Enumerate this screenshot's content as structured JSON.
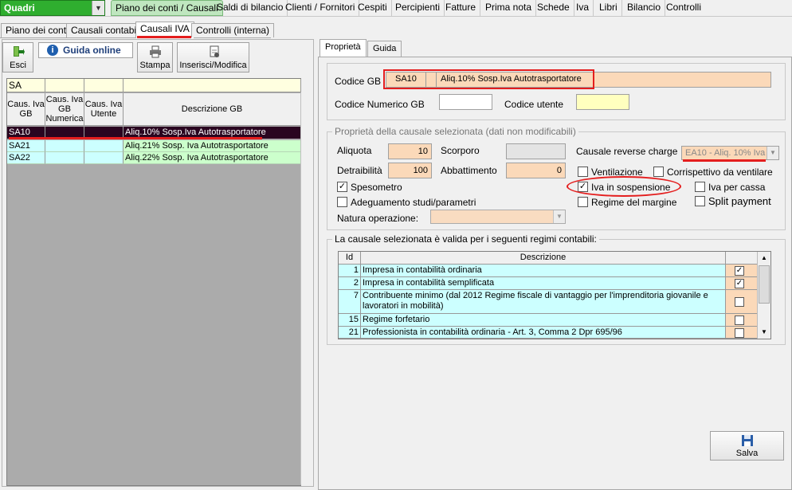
{
  "module_select": {
    "value": "Quadri"
  },
  "main_menu": [
    {
      "label": "Piano dei conti / Causali",
      "active": true
    },
    {
      "label": "Saldi di bilancio"
    },
    {
      "label": "Clienti / Fornitori"
    },
    {
      "label": "Cespiti"
    },
    {
      "label": "Percipienti"
    },
    {
      "label": "Fatture"
    },
    {
      "label": "Prima nota"
    },
    {
      "label": "Schede"
    },
    {
      "label": "Iva"
    },
    {
      "label": "Libri"
    },
    {
      "label": "Bilancio"
    },
    {
      "label": "Controlli"
    }
  ],
  "sub_tabs": [
    {
      "label": "Piano dei conti"
    },
    {
      "label": "Causali contabili"
    },
    {
      "label": "Causali IVA",
      "active": true
    },
    {
      "label": "Controlli (interna)"
    }
  ],
  "toolbar": {
    "esci": "Esci",
    "guida_online": "Guida online",
    "stampa": "Stampa",
    "inserisci_modifica": "Inserisci/Modifica"
  },
  "grid": {
    "filter_value": "SA",
    "headers": [
      "Caus. Iva GB",
      "Caus. Iva GB Numerica",
      "Caus. Iva Utente",
      "Descrizione GB"
    ],
    "rows": [
      {
        "code": "SA10",
        "numerica": "",
        "utente": "",
        "descrizione": "Aliq.10% Sosp.Iva Autotrasportatore",
        "selected": true
      },
      {
        "code": "SA21",
        "numerica": "",
        "utente": "",
        "descrizione": "Aliq.21% Sosp. Iva Autotrasportatore"
      },
      {
        "code": "SA22",
        "numerica": "",
        "utente": "",
        "descrizione": "Aliq.22% Sosp. Iva Autotrasportatore"
      }
    ]
  },
  "right_tabs": [
    {
      "label": "Proprietà",
      "active": true
    },
    {
      "label": "Guida"
    }
  ],
  "codice": {
    "codice_gb_label": "Codice GB",
    "codice_gb": "SA10",
    "descrizione": "Aliq.10% Sosp.Iva Autotrasportatore",
    "codice_numerico_label": "Codice Numerico GB",
    "codice_numerico": "",
    "codice_utente_label": "Codice utente",
    "codice_utente": ""
  },
  "proprieta": {
    "title": "Proprietà della causale selezionata (dati non modificabili)",
    "aliquota_label": "Aliquota",
    "aliquota": "10",
    "scorporo_label": "Scorporo",
    "scorporo": "",
    "detraibilita_label": "Detraibilità",
    "detraibilita": "100",
    "abbattimento_label": "Abbattimento",
    "abbattimento": "0",
    "reverse_label": "Causale reverse charge",
    "reverse_value": "EA10 - Aliq. 10% Iva",
    "natura_label": "Natura operazione:",
    "natura_value": "",
    "checks": {
      "spesometro": {
        "label": "Spesometro",
        "checked": true
      },
      "adeguamento": {
        "label": "Adeguamento studi/parametri",
        "checked": false
      },
      "ventilazione": {
        "label": "Ventilazione",
        "checked": false
      },
      "corrispettivo": {
        "label": "Corrispettivo da ventilare",
        "checked": false
      },
      "iva_sospensione": {
        "label": "Iva in sospensione",
        "checked": true
      },
      "iva_cassa": {
        "label": "Iva per cassa",
        "checked": false
      },
      "regime_margine": {
        "label": "Regime del margine",
        "checked": false
      },
      "split_payment": {
        "label": "Split payment",
        "checked": false
      }
    }
  },
  "regimi": {
    "title": "La causale selezionata è valida per i seguenti regimi contabili:",
    "headers": [
      "Id",
      "Descrizione"
    ],
    "rows": [
      {
        "id": "1",
        "descrizione": "Impresa  in contabilità ordinaria",
        "checked": true
      },
      {
        "id": "2",
        "descrizione": "Impresa  in contabilità semplificata",
        "checked": true
      },
      {
        "id": "7",
        "descrizione": "Contribuente minimo (dal 2012 Regime fiscale di vantaggio per l'imprenditoria giovanile e lavoratori in mobilità)",
        "checked": false
      },
      {
        "id": "15",
        "descrizione": "Regime forfetario",
        "checked": false
      },
      {
        "id": "21",
        "descrizione": "Professionista in contabilità ordinaria - Art. 3, Comma 2 Dpr 695/96",
        "checked": false
      }
    ]
  },
  "salva": "Salva"
}
